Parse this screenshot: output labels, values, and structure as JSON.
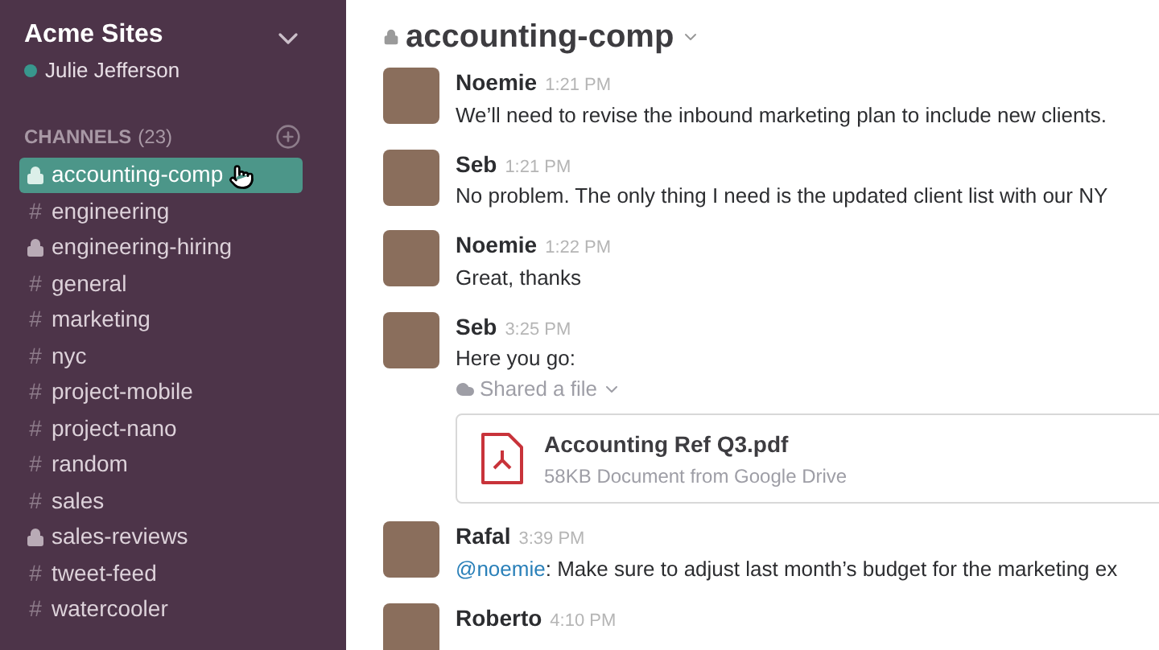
{
  "sidebar": {
    "team": "Acme Sites",
    "user": {
      "name": "Julie Jefferson",
      "online": true
    },
    "channels_header": {
      "label": "CHANNELS",
      "count": "(23)"
    },
    "channels": [
      {
        "name": "accounting-comp",
        "kind": "private",
        "selected": true
      },
      {
        "name": "engineering",
        "kind": "public",
        "prefix": "#",
        "selected": false
      },
      {
        "name": "engineering-hiring",
        "kind": "private",
        "selected": false
      },
      {
        "name": "general",
        "kind": "public",
        "prefix": "#",
        "selected": false
      },
      {
        "name": "marketing",
        "kind": "public",
        "prefix": "#",
        "selected": false
      },
      {
        "name": "nyc",
        "kind": "public",
        "prefix": "#",
        "selected": false
      },
      {
        "name": "project-mobile",
        "kind": "public",
        "prefix": "#",
        "selected": false
      },
      {
        "name": "project-nano",
        "kind": "public",
        "prefix": "#",
        "selected": false
      },
      {
        "name": "random",
        "kind": "public",
        "prefix": "#",
        "selected": false
      },
      {
        "name": "sales",
        "kind": "public",
        "prefix": "#",
        "selected": false
      },
      {
        "name": "sales-reviews",
        "kind": "private",
        "selected": false
      },
      {
        "name": "tweet-feed",
        "kind": "public",
        "prefix": "#",
        "selected": false
      },
      {
        "name": "watercooler",
        "kind": "public",
        "prefix": "#",
        "selected": false
      }
    ]
  },
  "channel": {
    "title": "accounting-comp",
    "kind": "private"
  },
  "messages": [
    {
      "author": "Noemie",
      "time": "1:21 PM",
      "text": "We’ll need to revise the inbound marketing plan to include new clients."
    },
    {
      "author": "Seb",
      "time": "1:21 PM",
      "text": "No problem. The only thing I need is the updated client list with our NY"
    },
    {
      "author": "Noemie",
      "time": "1:22 PM",
      "text": "Great, thanks"
    },
    {
      "author": "Seb",
      "time": "3:25 PM",
      "text": "Here you go:",
      "share": {
        "label": "Shared a file",
        "file": {
          "name": "Accounting Ref Q3.pdf",
          "meta": "58KB Document from Google Drive"
        }
      }
    },
    {
      "author": "Rafal",
      "time": "3:39 PM",
      "mention": "@noemie",
      "text": ": Make sure to adjust last month’s budget for the marketing ex"
    },
    {
      "author": "Roberto",
      "time": "4:10 PM"
    }
  ]
}
